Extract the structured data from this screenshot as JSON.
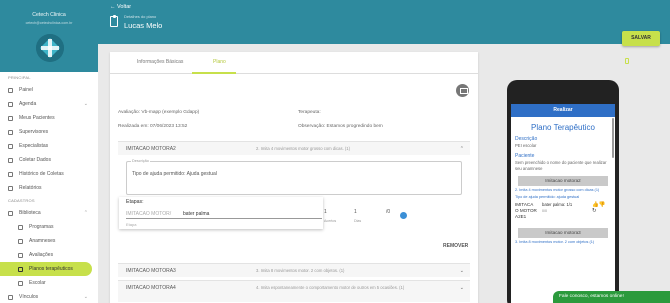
{
  "sidebar": {
    "org_name": "Cetech Clinica",
    "org_sub": "cetech@cetechclinica.com.br",
    "section_principal": "PRINCIPAL",
    "section_cadastros": "CADASTROS",
    "items": [
      {
        "label": "Painel"
      },
      {
        "label": "Agenda"
      },
      {
        "label": "Meus Pacientes"
      },
      {
        "label": "Supervisores"
      },
      {
        "label": "Especialistas"
      },
      {
        "label": "Coletar Dados"
      },
      {
        "label": "Histórico de Coletas"
      },
      {
        "label": "Relatórios"
      }
    ],
    "cad_items": [
      {
        "label": "Biblioteca"
      },
      {
        "label": "Programas"
      },
      {
        "label": "Anamneses"
      },
      {
        "label": "Avaliações"
      },
      {
        "label": "Planos terapêuticos"
      },
      {
        "label": "Escolar"
      },
      {
        "label": "Vínculos"
      }
    ]
  },
  "topbar": {
    "back_label": "Voltar",
    "breadcrumb": "Detalhes do plano",
    "title": "Lucas Melo",
    "save_label": "SALVAR"
  },
  "tabs": [
    {
      "label": "Informações Básicas"
    },
    {
      "label": "Plano"
    }
  ],
  "info": {
    "avaliacao": "Avaliação: Vb-mapp (exemplo Gdapp)",
    "realizada": "Realizada em: 07/06/2023 13:52",
    "terapeuta": "Terapeuta:",
    "observacao": "Observação: Estamos progredindo bem"
  },
  "accordions": [
    {
      "name": "IMITACAO MOTORA2",
      "desc": "2. Imita 4 movimentos motor grosso com dicas. (1)"
    },
    {
      "name": "IMITACAO MOTORA3",
      "desc": "3. Imita 8 movimentos motor. 2 com objetos. (1)"
    },
    {
      "name": "IMITACAO MOTORA4",
      "desc": "4. Imita espontaneamente o comportamento motor de outros em 5 ocasiões. (1)"
    }
  ],
  "description": {
    "label": "Descrição",
    "value": "Tipo de ajuda permitido: Ajuda gestual"
  },
  "etapa": {
    "name": "IMITACAO MOTOR",
    "value_a": "1",
    "value_b": "1",
    "sep": "/0",
    "sub_a": "Acertos",
    "sub_b": "Dias",
    "remover": "REMOVER"
  },
  "popup": {
    "label": "Etapas:",
    "name": "IMITACAO MOTOR/",
    "value": "bater palma",
    "sub": "Etapa"
  },
  "phone": {
    "header": "Realizar",
    "title": "Plano Terapêutico",
    "desc_label": "Descrição",
    "desc_value": "PEI escolar",
    "paciente_label": "Paciente",
    "paciente_value": "Sem preenchido o nome do paciente que realizar seu anamnese",
    "sect1": "Imitacao motora2",
    "link1": "2. Imita 4 movimentos motor grosso com dicas (1)",
    "link2": "Tipo de ajuda permitido: ajuda gestual",
    "row_name": "IMITACA O MOTOR A2E1",
    "row_mid": "bater palma: 1/1",
    "row_mid2": "0/0",
    "sect2": "Imitacao motora3",
    "link3": "3. Imita 8 movimentos motor. 2 com objetos (1)"
  },
  "chat": "Fale conosco, estamos online!",
  "colors": {
    "brand": "#2e8a9e",
    "accent": "#c7e04b",
    "phone_blue": "#2f6fc6",
    "chat_green": "#2b9a3c"
  }
}
